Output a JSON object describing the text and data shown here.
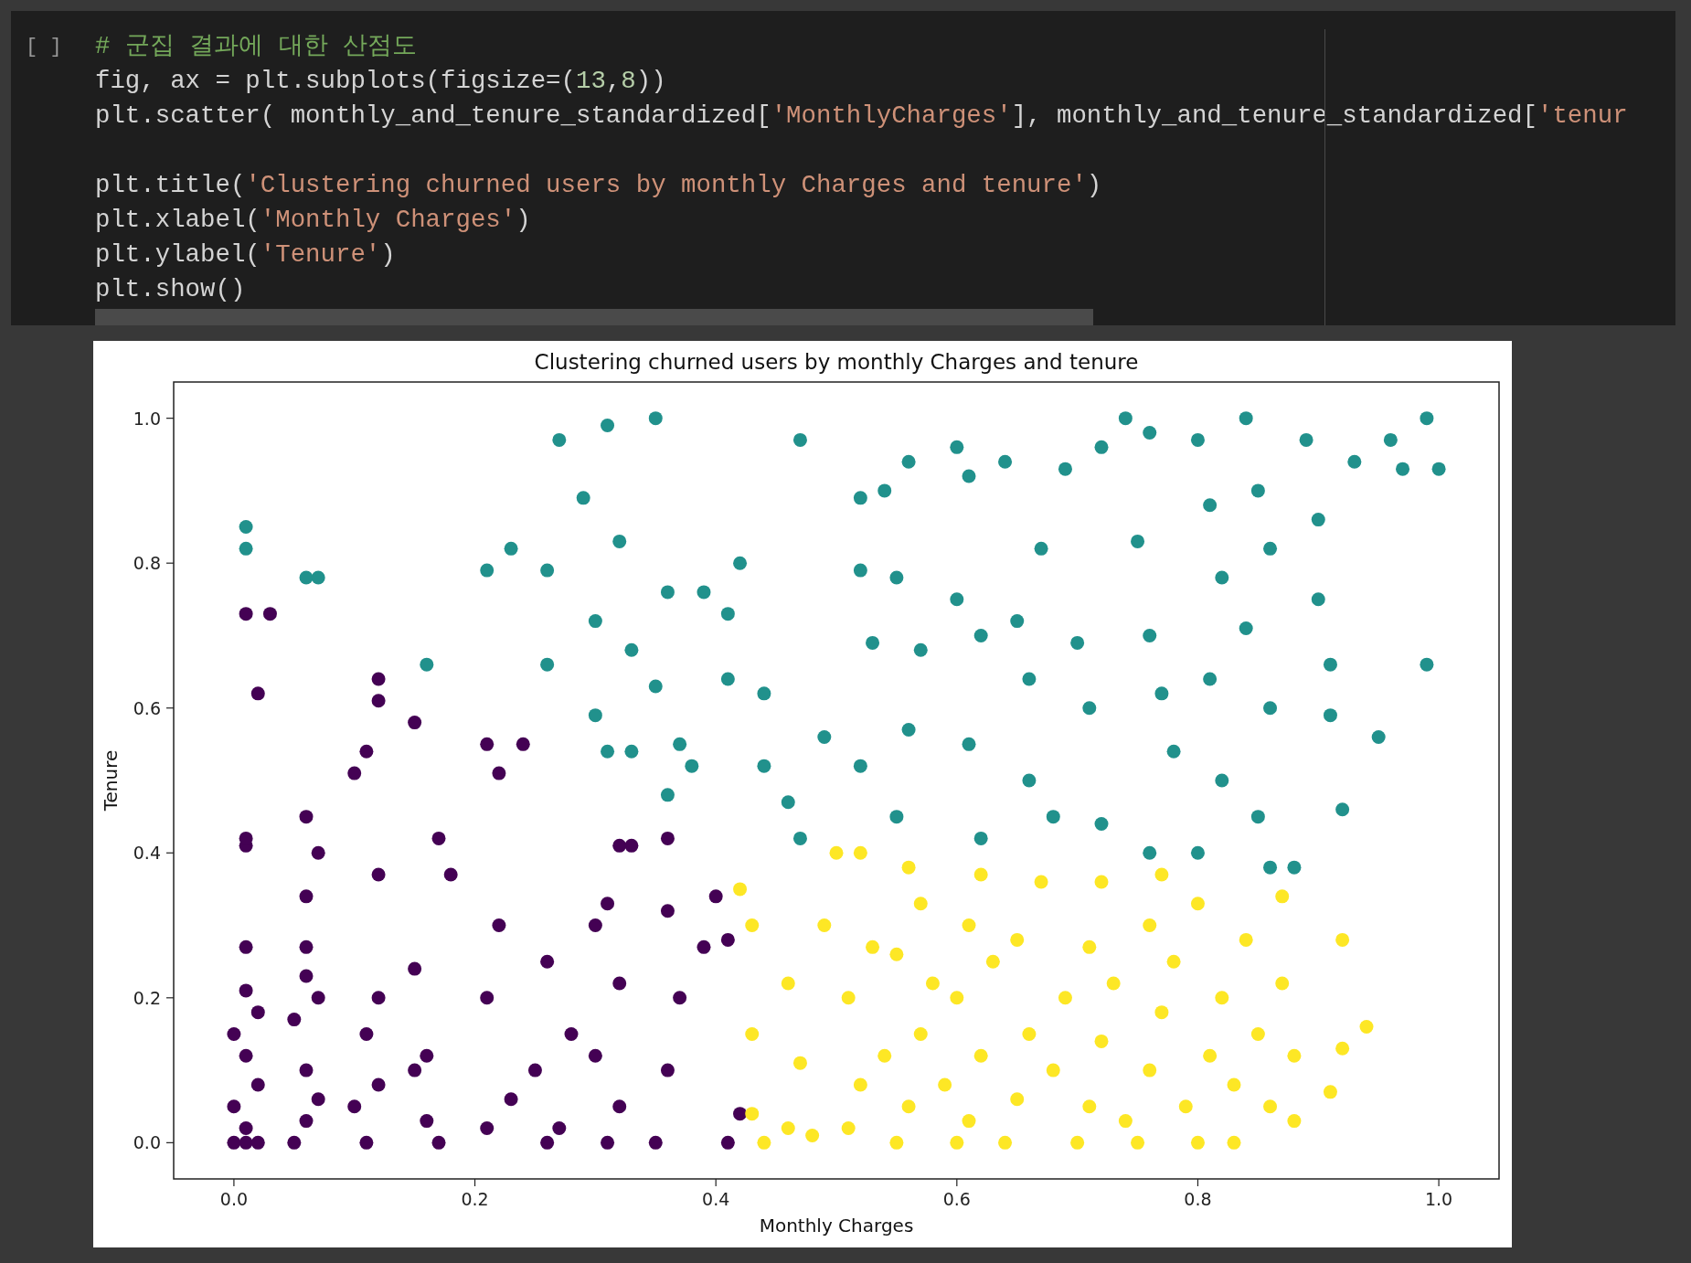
{
  "code_cell": {
    "run_indicator": "[ ]",
    "lines": [
      {
        "tokens": [
          {
            "kind": "comment",
            "text": "# 군집 결과에 대한 산점도"
          }
        ]
      },
      {
        "tokens": [
          {
            "kind": "plain",
            "text": "fig, ax = plt.subplots(figsize=("
          },
          {
            "kind": "number",
            "text": "13"
          },
          {
            "kind": "plain",
            "text": ","
          },
          {
            "kind": "number",
            "text": "8"
          },
          {
            "kind": "plain",
            "text": "))"
          }
        ]
      },
      {
        "tokens": [
          {
            "kind": "plain",
            "text": "plt.scatter( monthly_and_tenure_standardized["
          },
          {
            "kind": "string",
            "text": "'MonthlyCharges'"
          },
          {
            "kind": "plain",
            "text": "], monthly_and_tenure_standardized["
          },
          {
            "kind": "string",
            "text": "'tenur"
          }
        ]
      },
      {
        "blank_before": true,
        "tokens": [
          {
            "kind": "plain",
            "text": "plt.title("
          },
          {
            "kind": "string",
            "text": "'Clustering churned users by monthly Charges and tenure'"
          },
          {
            "kind": "plain",
            "text": ")"
          }
        ]
      },
      {
        "tokens": [
          {
            "kind": "plain",
            "text": "plt.xlabel("
          },
          {
            "kind": "string",
            "text": "'Monthly Charges'"
          },
          {
            "kind": "plain",
            "text": ")"
          }
        ]
      },
      {
        "tokens": [
          {
            "kind": "plain",
            "text": "plt.ylabel("
          },
          {
            "kind": "string",
            "text": "'Tenure'"
          },
          {
            "kind": "plain",
            "text": ")"
          }
        ]
      },
      {
        "tokens": [
          {
            "kind": "plain",
            "text": "plt.show()"
          }
        ]
      }
    ]
  },
  "output": {
    "chart_data": {
      "type": "scatter",
      "title": "Clustering churned users by monthly Charges and tenure",
      "xlabel": "Monthly Charges",
      "ylabel": "Tenure",
      "xlim": [
        -0.05,
        1.05
      ],
      "ylim": [
        -0.05,
        1.05
      ],
      "xticks": [
        {
          "value": 0,
          "label": "0.0"
        },
        {
          "value": 0.2,
          "label": "0.2"
        },
        {
          "value": 0.4,
          "label": "0.4"
        },
        {
          "value": 0.6,
          "label": "0.6"
        },
        {
          "value": 0.8,
          "label": "0.8"
        },
        {
          "value": 1,
          "label": "1.0"
        }
      ],
      "yticks": [
        {
          "value": 0,
          "label": "0.0"
        },
        {
          "value": 0.2,
          "label": "0.2"
        },
        {
          "value": 0.4,
          "label": "0.4"
        },
        {
          "value": 0.6,
          "label": "0.6"
        },
        {
          "value": 0.8,
          "label": "0.8"
        },
        {
          "value": 1,
          "label": "1.0"
        }
      ],
      "series": [
        {
          "color": "#440154",
          "x": [
            0,
            0.01,
            0.02,
            0.01,
            0,
            0.02,
            0.01,
            0,
            0.02,
            0.01,
            0.01,
            0.01,
            0.01,
            0.01,
            0.03,
            0.02,
            0.05,
            0.06,
            0.07,
            0.06,
            0.05,
            0.06,
            0.06,
            0.06,
            0.07,
            0.06,
            0.07,
            0.1,
            0.11,
            0.12,
            0.11,
            0.12,
            0.11,
            0.12,
            0.12,
            0.12,
            0.1,
            0.15,
            0.16,
            0.17,
            0.15,
            0.16,
            0.17,
            0.18,
            0.15,
            0.21,
            0.21,
            0.22,
            0.24,
            0.22,
            0.21,
            0.23,
            0.26,
            0.27,
            0.25,
            0.26,
            0.28,
            0.3,
            0.31,
            0.32,
            0.3,
            0.32,
            0.32,
            0.33,
            0.31,
            0.35,
            0.36,
            0.37,
            0.36,
            0.36,
            0.39,
            0.4,
            0.41,
            0.42,
            0.41
          ],
          "values": [
            0,
            0,
            0,
            0.02,
            0.05,
            0.08,
            0.12,
            0.15,
            0.18,
            0.21,
            0.27,
            0.41,
            0.42,
            0.73,
            0.73,
            0.62,
            0,
            0.03,
            0.06,
            0.1,
            0.17,
            0.23,
            0.27,
            0.34,
            0.4,
            0.45,
            0.2,
            0.05,
            0,
            0.08,
            0.15,
            0.2,
            0.54,
            0.61,
            0.64,
            0.37,
            0.51,
            0.58,
            0.03,
            0,
            0.24,
            0.12,
            0.42,
            0.37,
            0.1,
            0.02,
            0.55,
            0.51,
            0.55,
            0.3,
            0.2,
            0.06,
            0,
            0.02,
            0.1,
            0.25,
            0.15,
            0.3,
            0,
            0.05,
            0.12,
            0.22,
            0.41,
            0.41,
            0.33,
            0,
            0.1,
            0.2,
            0.32,
            0.42,
            0.27,
            0.34,
            0,
            0.04,
            0.28
          ]
        },
        {
          "color": "#21918c",
          "x": [
            0.01,
            0.01,
            0.06,
            0.07,
            0.16,
            0.21,
            0.23,
            0.26,
            0.27,
            0.26,
            0.29,
            0.31,
            0.3,
            0.32,
            0.33,
            0.3,
            0.31,
            0.33,
            0.35,
            0.36,
            0.35,
            0.37,
            0.36,
            0.38,
            0.39,
            0.41,
            0.42,
            0.41,
            0.44,
            0.44,
            0.46,
            0.47,
            0.47,
            0.49,
            0.52,
            0.52,
            0.53,
            0.52,
            0.54,
            0.55,
            0.56,
            0.57,
            0.56,
            0.55,
            0.6,
            0.61,
            0.6,
            0.62,
            0.61,
            0.62,
            0.64,
            0.65,
            0.66,
            0.67,
            0.66,
            0.68,
            0.69,
            0.7,
            0.72,
            0.71,
            0.72,
            0.74,
            0.76,
            0.75,
            0.76,
            0.77,
            0.78,
            0.76,
            0.8,
            0.81,
            0.82,
            0.81,
            0.82,
            0.8,
            0.84,
            0.85,
            0.86,
            0.84,
            0.86,
            0.85,
            0.88,
            0.89,
            0.9,
            0.9,
            0.91,
            0.91,
            0.92,
            0.93,
            0.95,
            0.96,
            0.97,
            0.99,
            1,
            0.99,
            0.86
          ],
          "values": [
            0.85,
            0.82,
            0.78,
            0.78,
            0.66,
            0.79,
            0.82,
            0.79,
            0.97,
            0.66,
            0.89,
            0.99,
            0.72,
            0.83,
            0.68,
            0.59,
            0.54,
            0.54,
            1,
            0.76,
            0.63,
            0.55,
            0.48,
            0.52,
            0.76,
            0.73,
            0.8,
            0.64,
            0.62,
            0.52,
            0.47,
            0.97,
            0.42,
            0.56,
            0.89,
            0.79,
            0.69,
            0.52,
            0.9,
            0.78,
            0.94,
            0.68,
            0.57,
            0.45,
            0.96,
            0.92,
            0.75,
            0.7,
            0.55,
            0.42,
            0.94,
            0.72,
            0.64,
            0.82,
            0.5,
            0.45,
            0.93,
            0.69,
            0.96,
            0.6,
            0.44,
            1,
            0.98,
            0.83,
            0.7,
            0.62,
            0.54,
            0.4,
            0.97,
            0.88,
            0.78,
            0.64,
            0.5,
            0.4,
            1,
            0.9,
            0.82,
            0.71,
            0.6,
            0.45,
            0.38,
            0.97,
            0.86,
            0.75,
            0.66,
            0.59,
            0.46,
            0.94,
            0.56,
            0.97,
            0.93,
            1,
            0.93,
            0.66,
            0.38
          ]
        },
        {
          "color": "#fde725",
          "x": [
            0.42,
            0.43,
            0.43,
            0.43,
            0.44,
            0.46,
            0.46,
            0.47,
            0.48,
            0.49,
            0.5,
            0.51,
            0.52,
            0.51,
            0.53,
            0.52,
            0.54,
            0.55,
            0.56,
            0.57,
            0.55,
            0.57,
            0.56,
            0.58,
            0.59,
            0.6,
            0.61,
            0.62,
            0.6,
            0.61,
            0.62,
            0.63,
            0.64,
            0.65,
            0.66,
            0.65,
            0.67,
            0.68,
            0.69,
            0.7,
            0.71,
            0.72,
            0.71,
            0.72,
            0.73,
            0.74,
            0.75,
            0.76,
            0.77,
            0.76,
            0.77,
            0.78,
            0.79,
            0.8,
            0.81,
            0.82,
            0.8,
            0.83,
            0.83,
            0.84,
            0.85,
            0.86,
            0.87,
            0.87,
            0.88,
            0.88,
            0.91,
            0.92,
            0.92,
            0.94
          ],
          "values": [
            0.35,
            0.3,
            0.15,
            0.04,
            0,
            0.02,
            0.22,
            0.11,
            0.01,
            0.3,
            0.4,
            0.02,
            0.08,
            0.2,
            0.27,
            0.4,
            0.12,
            0,
            0.05,
            0.15,
            0.26,
            0.33,
            0.38,
            0.22,
            0.08,
            0,
            0.03,
            0.12,
            0.2,
            0.3,
            0.37,
            0.25,
            0,
            0.06,
            0.15,
            0.28,
            0.36,
            0.1,
            0.2,
            0,
            0.05,
            0.14,
            0.27,
            0.36,
            0.22,
            0.03,
            0,
            0.1,
            0.18,
            0.3,
            0.37,
            0.25,
            0.05,
            0,
            0.12,
            0.2,
            0.33,
            0.08,
            0,
            0.28,
            0.15,
            0.05,
            0.22,
            0.34,
            0.12,
            0.03,
            0.07,
            0.13,
            0.28,
            0.16
          ]
        }
      ]
    }
  }
}
